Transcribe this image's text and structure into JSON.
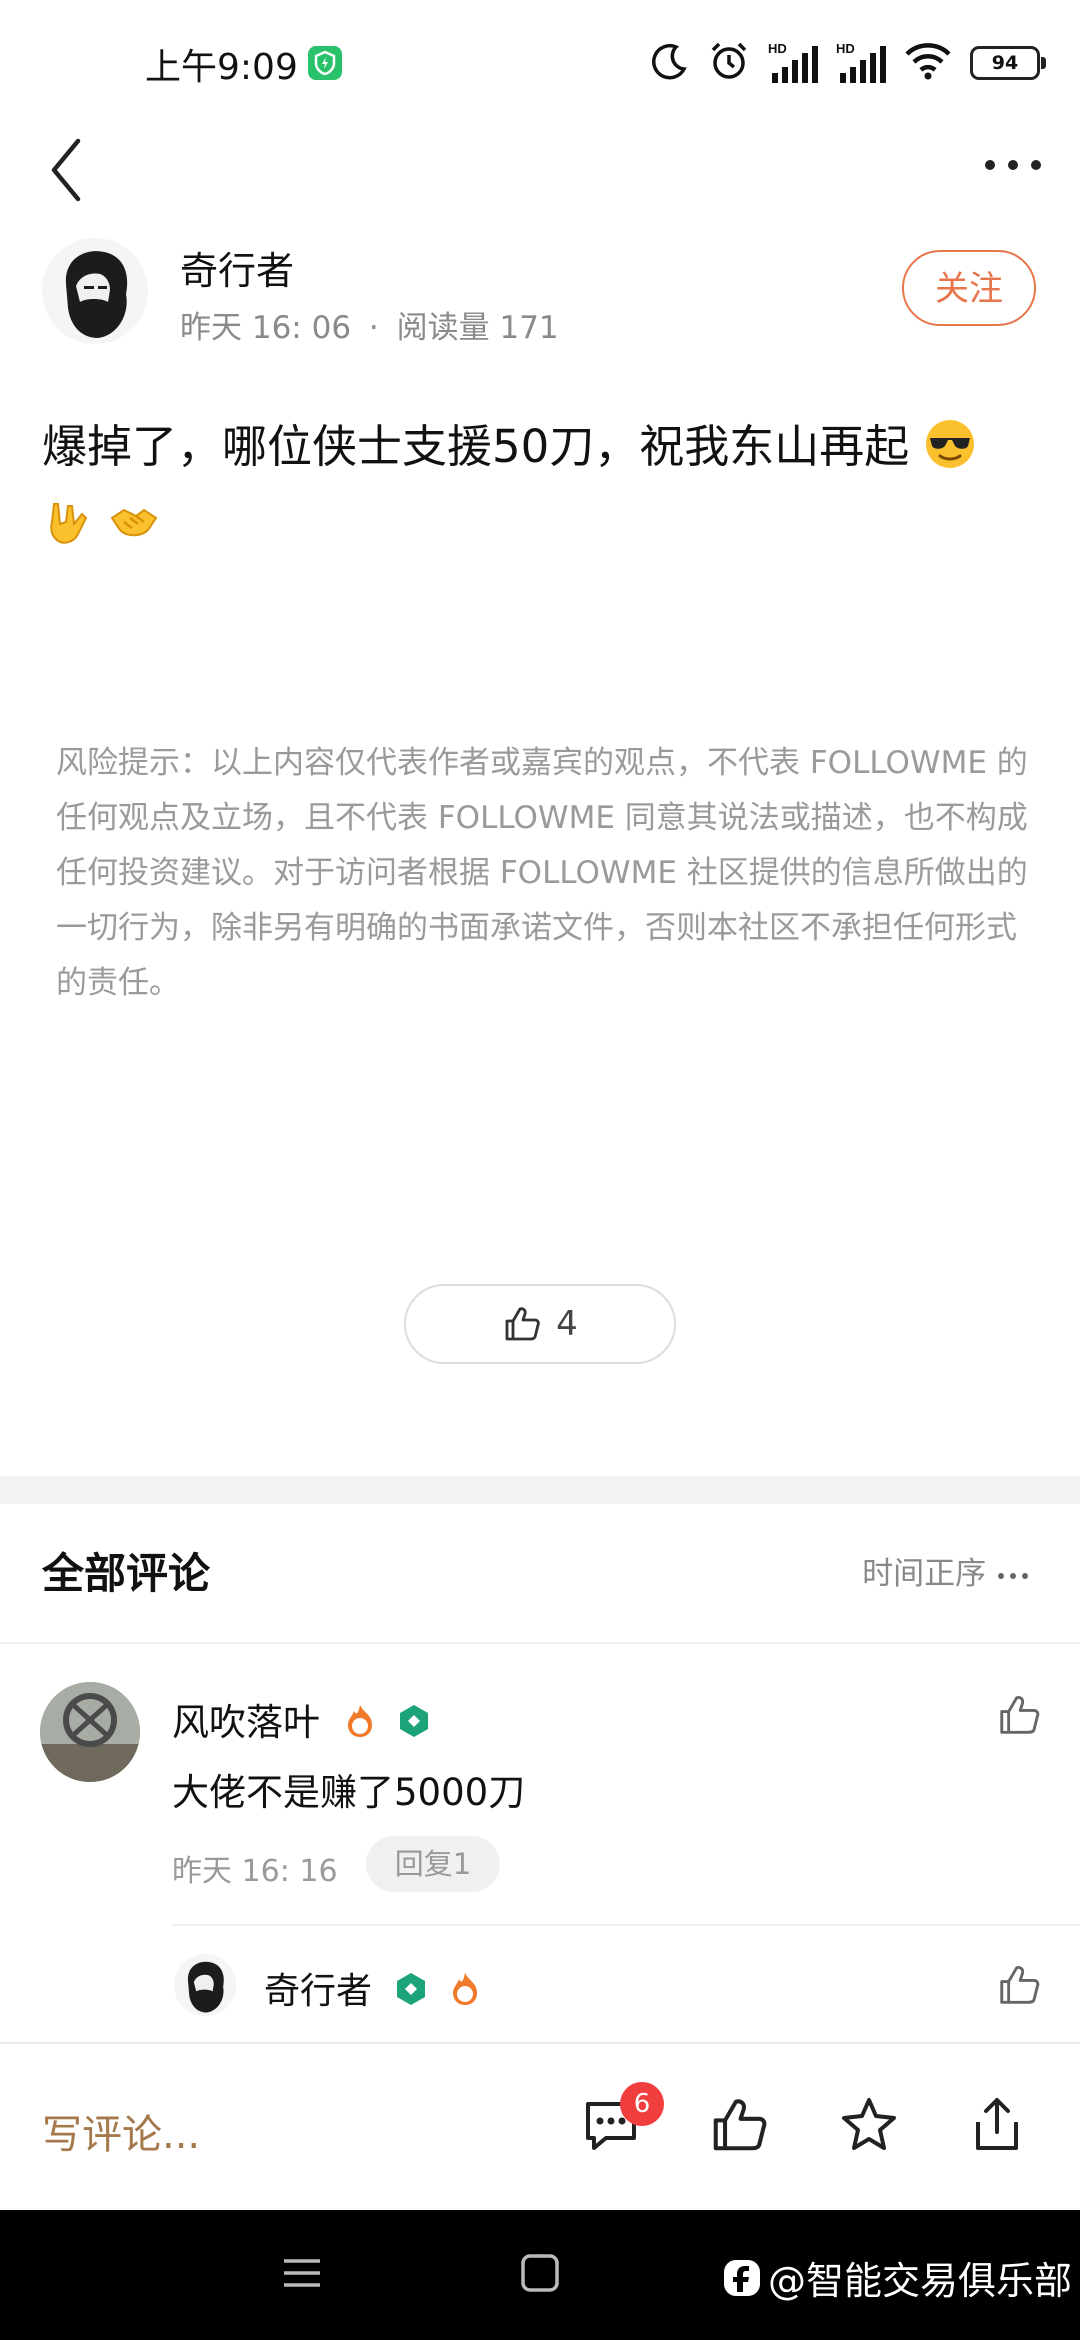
{
  "status_bar": {
    "time": "上午9:09",
    "battery": "94",
    "hd_label": "HD"
  },
  "post": {
    "author": "奇行者",
    "time": "昨天 16: 06",
    "separator": "·",
    "read_label": "阅读量 171",
    "follow_label": "关注",
    "text": "爆掉了，哪位侠士支援50刀，祝我东山再起",
    "likes": "4"
  },
  "disclaimer": "风险提示：以上内容仅代表作者或嘉宾的观点，不代表 FOLLOWME 的任何观点及立场，且不代表 FOLLOWME 同意其说法或描述，也不构成任何投资建议。对于访问者根据 FOLLOWME 社区提供的信息所做出的一切行为，除非另有明确的书面承诺文件，否则本社区不承担任何形式的责任。",
  "comments_section": {
    "title": "全部评论",
    "sort_label": "时间正序"
  },
  "comments": [
    {
      "author": "风吹落叶",
      "text": "大佬不是赚了5000刀",
      "time": "昨天 16: 16",
      "reply_label": "回复1"
    }
  ],
  "reply": {
    "author": "奇行者"
  },
  "action_bar": {
    "write_placeholder": "写评论...",
    "comment_count": "6"
  },
  "watermark": "@智能交易俱乐部",
  "colors": {
    "accent": "#e8764c",
    "badge_red": "#f03d3d",
    "write_text": "#a4794b"
  }
}
